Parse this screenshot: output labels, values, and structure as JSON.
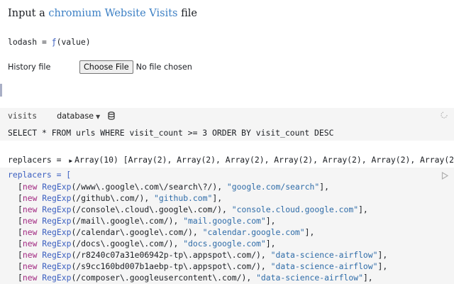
{
  "title": {
    "prefix": "Input a",
    "link_chromium": "chromium",
    "link_rest": "Website Visits",
    "suffix": "file"
  },
  "lodash": {
    "name": "lodash",
    "eq": " = ",
    "fn": "ƒ",
    "args": "(value)"
  },
  "history": {
    "label": "History file",
    "button": "Choose File",
    "status": "No file chosen"
  },
  "sql_cell": {
    "name": "visits",
    "database_label": "database",
    "query": "SELECT * FROM urls WHERE visit_count >= 3 ORDER BY visit_count DESC"
  },
  "replacers_output": {
    "name": "replacers",
    "eq": " = ",
    "summary": "Array(10) [Array(2), Array(2), Array(2), Array(2), Array(2), Array(2), Array(2), Array(2), Ar"
  },
  "code_cell": {
    "first_line": "replacers = [",
    "keyword": "new",
    "ctor": "RegExp",
    "rows": [
      {
        "pattern": "(/www\\.google\\.com\\/search\\?/)",
        "label": "\"google.com/search\""
      },
      {
        "pattern": "(/github\\.com/)",
        "label": "\"github.com\""
      },
      {
        "pattern": "(/console\\.cloud\\.google\\.com/)",
        "label": "\"console.cloud.google.com\""
      },
      {
        "pattern": "(/mail\\.google\\.com/)",
        "label": "\"mail.google.com\""
      },
      {
        "pattern": "(/calendar\\.google\\.com/)",
        "label": "\"calendar.google.com\""
      },
      {
        "pattern": "(/docs\\.google\\.com/)",
        "label": "\"docs.google.com\""
      },
      {
        "pattern": "(/r8240c07a31e06942p-tp\\.appspot\\.com/)",
        "label": "\"data-science-airflow\""
      },
      {
        "pattern": "(/s9cc160bd007b1aebp-tp\\.appspot\\.com/)",
        "label": "\"data-science-airflow\""
      },
      {
        "pattern": "(/composer\\.googleusercontent\\.com/)",
        "label": "\"data-science-airflow\""
      }
    ]
  },
  "icons": {
    "database": "database-icon",
    "refresh": "refresh-icon",
    "run": "run-icon",
    "expand": "triangle-right-icon"
  },
  "colors": {
    "link": "#3b5fc0",
    "keyword": "#a22a82",
    "string": "#2f6ca8",
    "cell_bg": "#f5f5f5"
  }
}
